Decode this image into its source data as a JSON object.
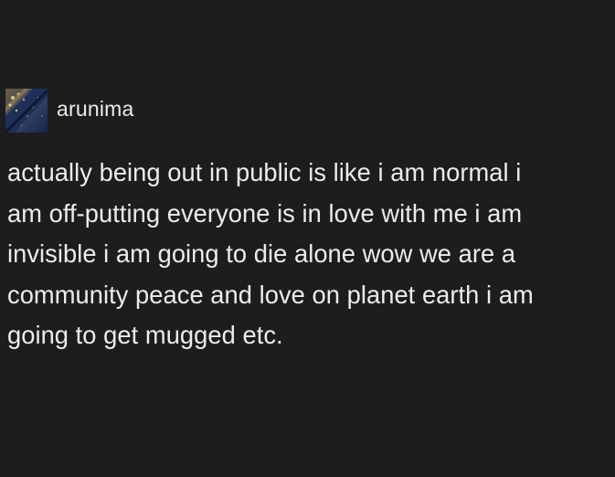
{
  "post": {
    "author": {
      "username": "arunima",
      "avatar_icon": "avatar-image"
    },
    "body_lines": [
      "actually being out in public is like i am normal i",
      "am off-putting everyone is in love with me i am",
      "invisible i am going to die alone wow we are a",
      "community peace and love on planet earth i am",
      "going to get mugged etc."
    ]
  },
  "colors": {
    "background": "#1d1d1f",
    "text": "#ececec"
  }
}
